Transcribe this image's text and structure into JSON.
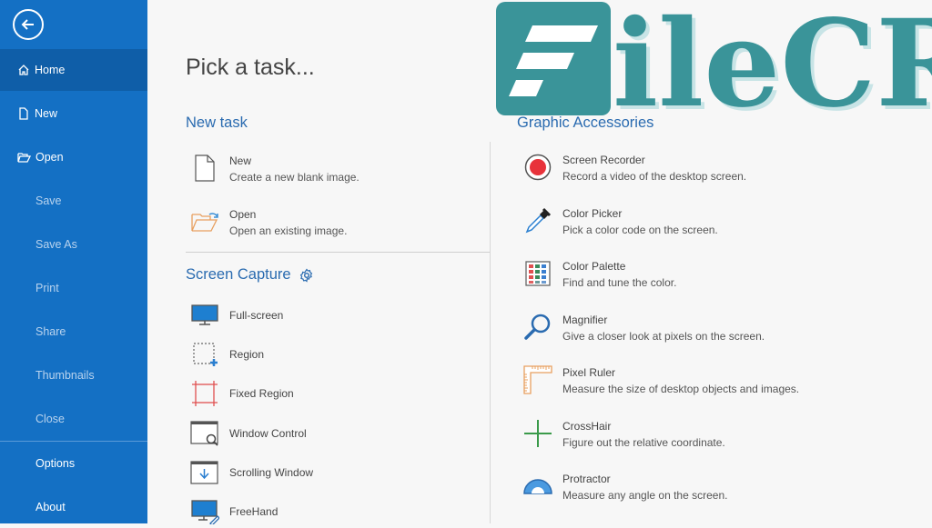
{
  "sidebar": {
    "back_icon": "back-arrow-icon",
    "items": [
      {
        "label": "Home",
        "icon": "home-icon",
        "state": "active"
      },
      {
        "label": "New",
        "icon": "new-file-icon",
        "state": "enabled"
      },
      {
        "label": "Open",
        "icon": "folder-open-icon",
        "state": "enabled"
      },
      {
        "label": "Save",
        "state": "disabled"
      },
      {
        "label": "Save As",
        "state": "disabled"
      },
      {
        "label": "Print",
        "state": "disabled"
      },
      {
        "label": "Share",
        "state": "disabled"
      },
      {
        "label": "Thumbnails",
        "state": "disabled"
      },
      {
        "label": "Close",
        "state": "disabled"
      },
      {
        "label": "Options",
        "state": "enabled"
      },
      {
        "label": "About",
        "state": "enabled"
      }
    ]
  },
  "main": {
    "title": "Pick a task...",
    "new_task": {
      "heading": "New task",
      "items": [
        {
          "title": "New",
          "desc": "Create a new blank image.",
          "icon": "blank-page-icon"
        },
        {
          "title": "Open",
          "desc": "Open an existing image.",
          "icon": "open-folder-icon"
        }
      ]
    },
    "screen_capture": {
      "heading": "Screen Capture",
      "settings_icon": "gear-icon",
      "items": [
        {
          "title": "Full-screen",
          "icon": "monitor-icon"
        },
        {
          "title": "Region",
          "icon": "region-select-icon"
        },
        {
          "title": "Fixed Region",
          "icon": "fixed-region-icon"
        },
        {
          "title": "Window Control",
          "icon": "window-search-icon"
        },
        {
          "title": "Scrolling Window",
          "icon": "scrolling-window-icon"
        },
        {
          "title": "FreeHand",
          "icon": "freehand-icon"
        }
      ]
    },
    "graphic_accessories": {
      "heading": "Graphic Accessories",
      "items": [
        {
          "title": "Screen Recorder",
          "desc": "Record a video of the desktop screen.",
          "icon": "record-icon"
        },
        {
          "title": "Color Picker",
          "desc": "Pick a color code on the screen.",
          "icon": "eyedropper-icon"
        },
        {
          "title": "Color Palette",
          "desc": "Find and tune the color.",
          "icon": "palette-icon"
        },
        {
          "title": "Magnifier",
          "desc": "Give a closer look at pixels on the screen.",
          "icon": "magnifier-icon"
        },
        {
          "title": "Pixel Ruler",
          "desc": "Measure the size of desktop objects and images.",
          "icon": "ruler-icon"
        },
        {
          "title": "CrossHair",
          "desc": "Figure out the relative coordinate.",
          "icon": "crosshair-icon"
        },
        {
          "title": "Protractor",
          "desc": "Measure any angle on the screen.",
          "icon": "protractor-icon"
        }
      ]
    }
  },
  "watermark": {
    "text": "ileCR",
    "color": "#3a9499"
  },
  "colors": {
    "sidebar": "#1470c4",
    "sidebar_active": "#0f5ea8",
    "heading": "#2a6bb0"
  }
}
